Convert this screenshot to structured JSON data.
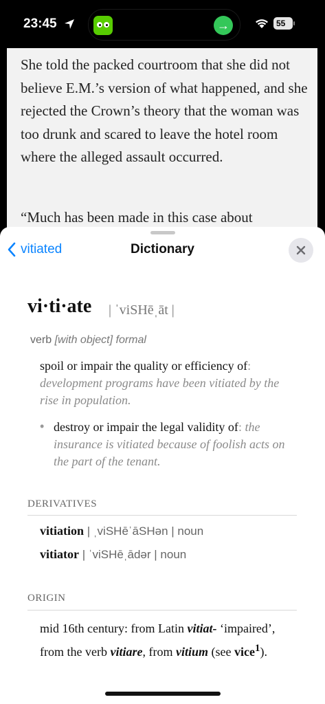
{
  "status_bar": {
    "time": "23:45",
    "battery": "55"
  },
  "article": {
    "paragraph1": "She told the packed courtroom that she did not believe E.M.’s version of what happened, and she rejected the Crown’s theory that the woman was too drunk and scared to leave the hotel room where the alleged assault occurred.",
    "paragraph2": "“Much has been made in this case about"
  },
  "sheet": {
    "back_label": "vitiated",
    "title": "Dictionary"
  },
  "entry": {
    "headword": "vi·ti·ate",
    "pronunciation": "| ˈviSHēˌāt |",
    "pos": "verb",
    "pos_qualifier": "[with object] formal",
    "def1": "spoil or impair the quality or efficiency of",
    "def1_example": "development programs have been vitiated by the rise in population.",
    "def2": "destroy or impair the legal validity of",
    "def2_example": "the insurance is vitiated because of foolish acts on the part of the tenant."
  },
  "derivatives": {
    "label": "DERIVATIVES",
    "items": [
      {
        "word": "vitiation",
        "pron": "| ˌviSHēˈāSHən | noun"
      },
      {
        "word": "vitiator",
        "pron": "| ˈviSHēˌādər | noun"
      }
    ]
  },
  "origin": {
    "label": "ORIGIN",
    "t1": "mid 16th century: from Latin ",
    "w1": "vitiat-",
    "t2": " ‘impaired’, from the verb ",
    "w2": "vitiare",
    "t3": ", from ",
    "w3": "vitium",
    "t4": " (see ",
    "w4": "vice",
    "sup": "1",
    "t5": ")."
  },
  "colors": {
    "accent": "#0a84ff",
    "island_app": "#58cc02",
    "island_action": "#34c759"
  }
}
